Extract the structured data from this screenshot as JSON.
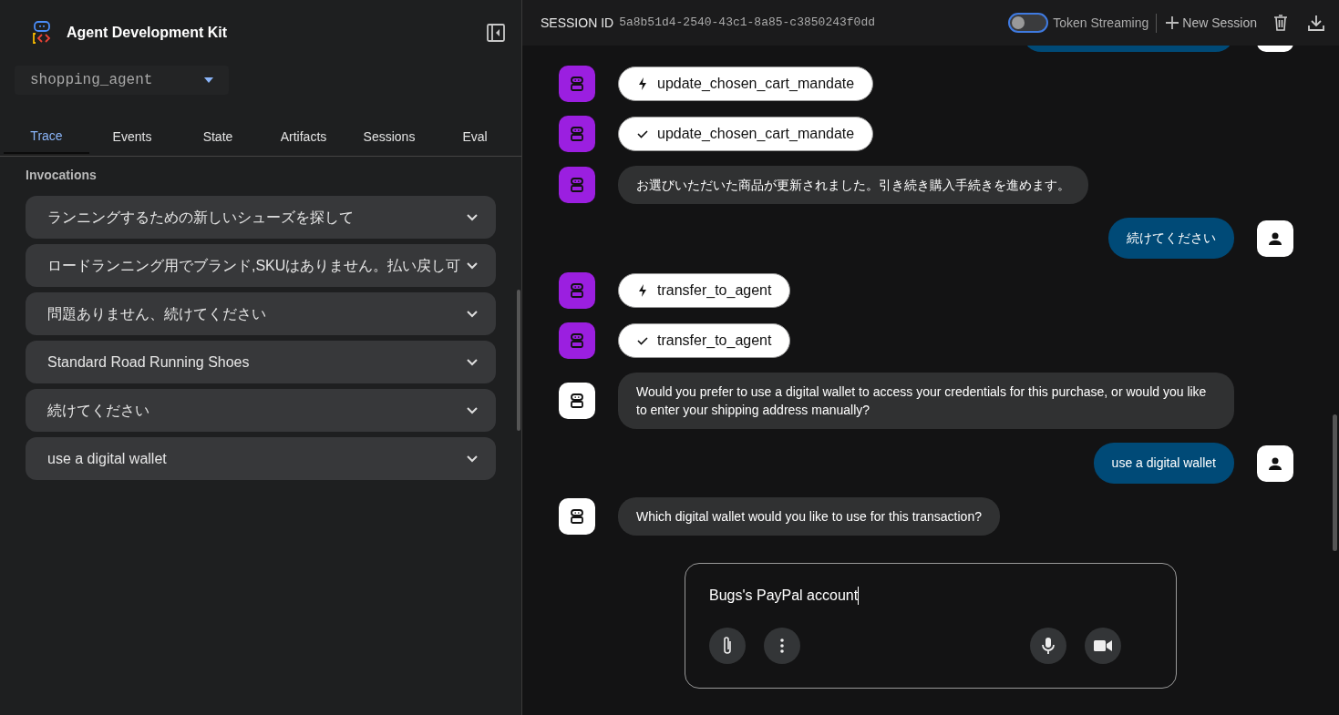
{
  "sidebar": {
    "title": "Agent Development Kit",
    "agent_select": {
      "value": "shopping_agent"
    },
    "tabs": [
      {
        "label": "Trace",
        "selected": true
      },
      {
        "label": "Events",
        "selected": false
      },
      {
        "label": "State",
        "selected": false
      },
      {
        "label": "Artifacts",
        "selected": false
      },
      {
        "label": "Sessions",
        "selected": false
      },
      {
        "label": "Eval",
        "selected": false
      }
    ],
    "section_title": "Invocations",
    "invocations": [
      {
        "text": "ランニングするための新しいシューズを探して",
        "expanded": false
      },
      {
        "text": "ロードランニング用でブランド,SKUはありません。払い戻し可",
        "expanded": false
      },
      {
        "text": "問題ありません、続けてください",
        "expanded": false
      },
      {
        "text": "Standard Road Running Shoes",
        "expanded": false
      },
      {
        "text": "続けてください",
        "expanded": false
      },
      {
        "text": "use a digital wallet",
        "expanded": false
      }
    ]
  },
  "header": {
    "session_label": "SESSION ID",
    "session_id": "5a8b51d4-2540-43c1-8a85-c3850243f0dd",
    "token_streaming": {
      "label": "Token Streaming",
      "on": false
    },
    "new_session": "New Session"
  },
  "messages": [
    {
      "kind": "user"
    },
    {
      "kind": "tool_call",
      "text": "update_chosen_cart_mandate",
      "color": "#9b1fe0"
    },
    {
      "kind": "tool_result",
      "text": "update_chosen_cart_mandate",
      "color": "#9b1fe0"
    },
    {
      "kind": "agent",
      "text": "お選びいただいた商品が更新されました。引き続き購入手続きを進めます。",
      "color": "#9b1fe0"
    },
    {
      "kind": "user",
      "text": "続けてください"
    },
    {
      "kind": "tool_call",
      "text": "transfer_to_agent",
      "color": "#9b1fe0"
    },
    {
      "kind": "tool_result",
      "text": "transfer_to_agent",
      "color": "#9b1fe0"
    },
    {
      "kind": "agent",
      "text": "Would you prefer to use a digital wallet to access your credentials for this purchase, or would you like to enter your shipping address manually?",
      "color": "#ffffff"
    },
    {
      "kind": "user",
      "text": "use a digital wallet"
    },
    {
      "kind": "agent",
      "text": "Which digital wallet would you like to use for this transaction?",
      "color": "#ffffff"
    }
  ],
  "composer": {
    "value": "Bugs's PayPal account"
  }
}
